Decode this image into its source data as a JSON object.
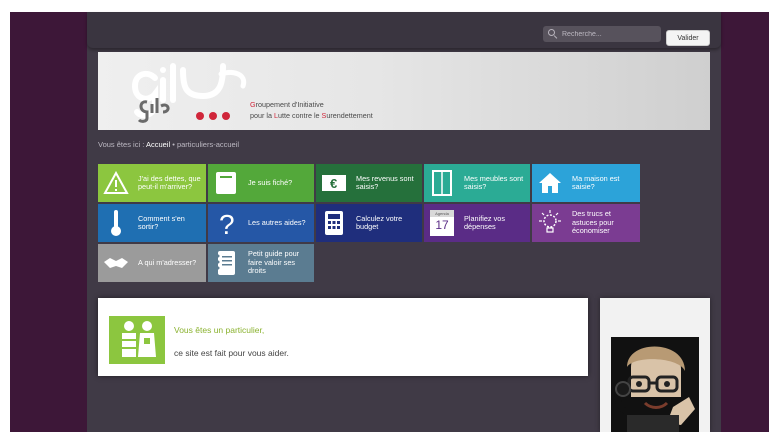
{
  "header": {
    "search_placeholder": "Recherche...",
    "search_button": "Valider"
  },
  "logo": {
    "line1_initial": "G",
    "line1_rest": "roupement d'Initiative",
    "line2_prefix": "pour la ",
    "line2_initial1": "L",
    "line2_mid": "utte contre le ",
    "line2_initial2": "S",
    "line2_rest": "urendettement"
  },
  "breadcrumb": {
    "prefix": "Vous êtes ici : ",
    "home": "Accueil",
    "sep": " • ",
    "current": "particuliers-accueil"
  },
  "tiles": [
    {
      "label": "J'ai des dettes, que peut-il m'arriver?",
      "color": "#8cc63f",
      "icon": "warning-icon"
    },
    {
      "label": "Je suis fiché?",
      "color": "#53a83a",
      "icon": "card-icon"
    },
    {
      "label": "Mes revenus sont saisis?",
      "color": "#25703b",
      "icon": "euro-icon"
    },
    {
      "label": "Mes meubles sont saisis?",
      "color": "#2bab95",
      "icon": "wardrobe-icon"
    },
    {
      "label": "Ma maison est saisie?",
      "color": "#2ca3d9",
      "icon": "house-icon"
    },
    {
      "label": "Comment s'en sortir?",
      "color": "#1f6fb2",
      "icon": "thermometer-icon"
    },
    {
      "label": "Les autres aides?",
      "color": "#2557a6",
      "icon": "question-icon"
    },
    {
      "label": "Calculez votre budget",
      "color": "#1f2e7c",
      "icon": "calculator-icon"
    },
    {
      "label": "Planifiez vos dépenses",
      "color": "#5a2c86",
      "icon": "calendar-icon"
    },
    {
      "label": "Des trucs et astuces pour économiser",
      "color": "#7b3c92",
      "icon": "lightbulb-icon"
    },
    {
      "label": "A qui m'adresser?",
      "color": "#9b9b9b",
      "icon": "handshake-icon"
    },
    {
      "label": "Petit guide pour faire valoir ses droits",
      "color": "#5b7c91",
      "icon": "notebook-icon"
    }
  ],
  "calendar_month": "Agenda",
  "calendar_day": "17",
  "intro": {
    "title": "Vous êtes un particulier,",
    "subtitle": "ce site est fait pour vous aider."
  },
  "colors": {
    "page_bg": "#3d1738",
    "panel": "#403a46",
    "accent_green": "#8cc63f",
    "logo_red": "#d0263a"
  }
}
